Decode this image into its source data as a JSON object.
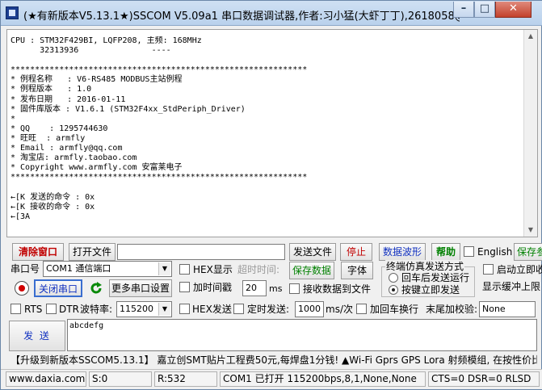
{
  "window": {
    "title": "(★有新版本V5.13.1★)SSCOM V5.09a1 串口数据调试器,作者:习小猛(大虾丁丁),2618058@qq.co...",
    "minimize_glyph": "–",
    "maximize_glyph": "□",
    "close_glyph": "✕"
  },
  "receive": {
    "lines": [
      "CPU : STM32F429BI, LQFP208, 主频: 168MHz",
      "      32313936               ----",
      "",
      "*************************************************************",
      "* 例程名称   : V6-RS485 MODBUS主站例程",
      "* 例程版本   : 1.0",
      "* 发布日期   : 2016-01-11",
      "* 固件库版本 : V1.6.1 (STM32F4xx_StdPeriph_Driver)",
      "*",
      "* QQ    : 1295744630",
      "* 旺旺  : armfly",
      "* Email : armfly@qq.com",
      "* 淘宝店: armfly.taobao.com",
      "* Copyright www.armfly.com 安富莱电子",
      "*************************************************************",
      "",
      "←[K 发送的命令 : 0x",
      "←[K 接收的命令 : 0x",
      "←[3A"
    ]
  },
  "toolbar": {
    "clear_window": "清除窗口",
    "open_file": "打开文件",
    "file_path": "",
    "send_file": "发送文件",
    "stop": "停止",
    "data_waveform": "数据波形",
    "help": "帮助",
    "english": "English",
    "save_params": "保存参数"
  },
  "port": {
    "port_label": "串口号",
    "port_value": "COM1 通信端口",
    "hex_display": "HEX显示",
    "timeout_label": "超时时间:",
    "save_data": "保存数据",
    "font": "字体",
    "terminal_group": "终端仿真发送方式",
    "carriage_return": "回车后发送运行",
    "key_immediate": "按键立即发送",
    "auto_wrap": "启动立即收",
    "show_buffer": "显示缓冲上限",
    "close_port": "关闭串口",
    "more_settings": "更多串口设置",
    "add_timestamp": "加时间戳",
    "interval_value": "20",
    "interval_unit": "ms",
    "recv_to_file": "接收数据到文件",
    "rts": "RTS",
    "dtr": "DTR",
    "baud_label": "波特率:",
    "baud_value": "115200",
    "hex_send": "HEX发送",
    "timed_send": "定时发送:",
    "timed_value": "1000",
    "timed_unit": "ms/次",
    "add_crlf": "加回车换行",
    "checksum_label": "末尾加校验:",
    "checksum_value": "None"
  },
  "send": {
    "button": "发 送",
    "text": "abcdefg"
  },
  "ad": {
    "text": "【升级到新版本SSCOM5.13.1】   嘉立创SMT贴片工程费50元,每焊盘1分钱! ▲Wi-Fi Gprs GPS Lora 射频模组, 在按性价比"
  },
  "status": {
    "website": "www.daxia.com",
    "sent": "S:0",
    "received": "R:532",
    "port_status": "COM1 已打开  115200bps,8,1,None,None",
    "signals": "CTS=0 DSR=0 RLSD"
  },
  "colors": {
    "titlebar": "#cfe0f3",
    "red_label": "#c00000",
    "blue_label": "#1030c0",
    "green_label": "#008000"
  },
  "icons": [
    "app-icon",
    "record-icon",
    "refresh-icon",
    "checkbox",
    "radio"
  ]
}
